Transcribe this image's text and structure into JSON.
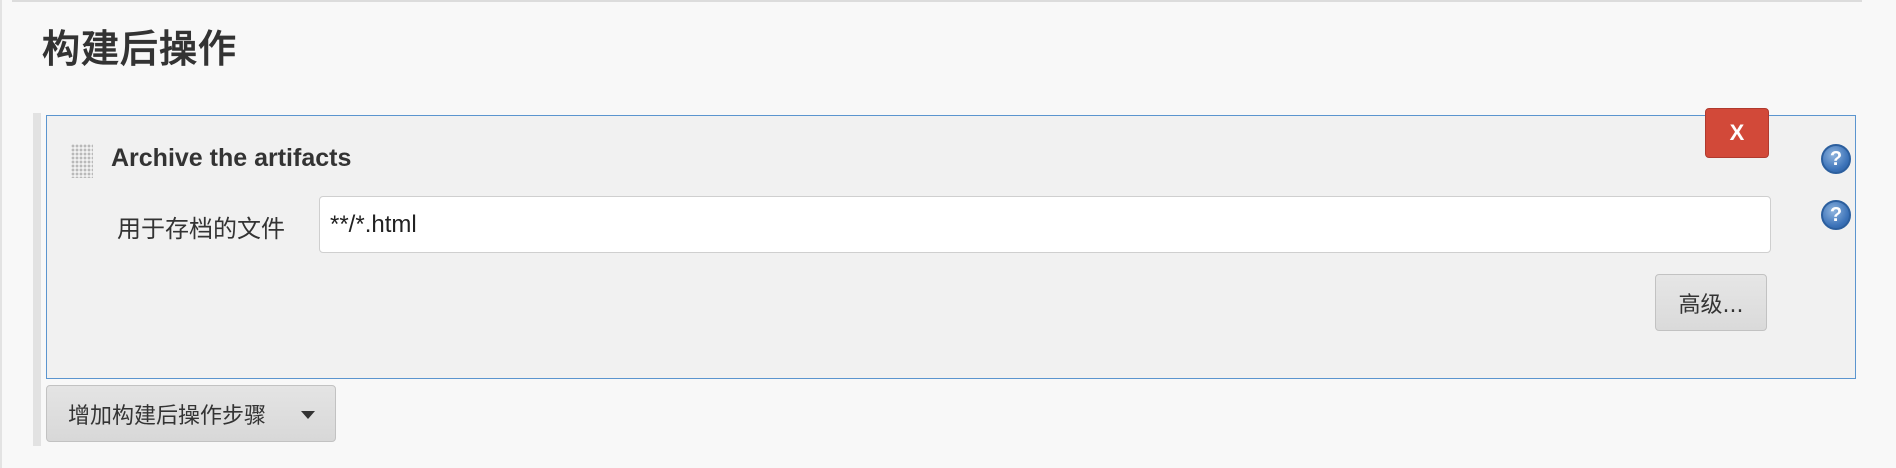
{
  "section": {
    "title": "构建后操作"
  },
  "step": {
    "title": "Archive the artifacts",
    "delete_label": "X",
    "help_glyph": "?",
    "field": {
      "label": "用于存档的文件",
      "value": "**/*.html"
    },
    "advanced_label": "高级..."
  },
  "add_step": {
    "label": "增加构建后操作步骤",
    "icon": "caret-down-icon"
  },
  "colors": {
    "panel_border": "#5b95cf",
    "delete_button": "#d24939",
    "help_icon": "#3b72b8",
    "background": "#f8f8f8"
  }
}
